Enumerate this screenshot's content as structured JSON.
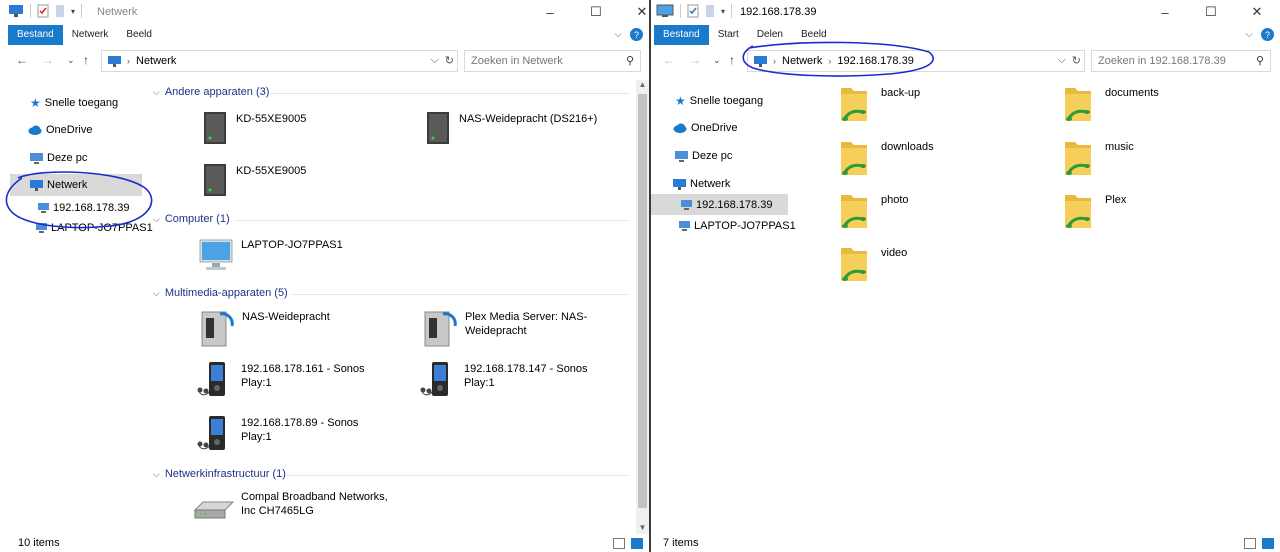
{
  "left": {
    "title": "Netwerk",
    "ribbon_tabs": [
      "Bestand",
      "Netwerk",
      "Beeld"
    ],
    "address": [
      "Netwerk"
    ],
    "search_placeholder": "Zoeken in Netwerk",
    "nav": [
      "Snelle toegang",
      "OneDrive",
      "Deze pc",
      "Netwerk",
      "192.168.178.39",
      "LAPTOP-JO7PPAS1"
    ],
    "groups": [
      {
        "header": "Andere apparaten (3)",
        "items": [
          "KD-55XE9005",
          "NAS-Weidepracht (DS216+)",
          "KD-55XE9005"
        ]
      },
      {
        "header": "Computer (1)",
        "items": [
          "LAPTOP-JO7PPAS1"
        ]
      },
      {
        "header": "Multimedia-apparaten (5)",
        "items": [
          "NAS-Weidepracht",
          "Plex Media Server: NAS-Weidepracht",
          "192.168.178.161 - Sonos Play:1",
          "192.168.178.147 - Sonos Play:1",
          "192.168.178.89 - Sonos Play:1"
        ]
      },
      {
        "header": "Netwerkinfrastructuur (1)",
        "items": [
          "Compal Broadband Networks, Inc CH7465LG"
        ]
      }
    ],
    "status": "10 items"
  },
  "right": {
    "title": "192.168.178.39",
    "ribbon_tabs": [
      "Bestand",
      "Start",
      "Delen",
      "Beeld"
    ],
    "address": [
      "Netwerk",
      "192.168.178.39"
    ],
    "search_placeholder": "Zoeken in 192.168.178.39",
    "nav": [
      "Snelle toegang",
      "OneDrive",
      "Deze pc",
      "Netwerk",
      "192.168.178.39",
      "LAPTOP-JO7PPAS1"
    ],
    "folders": [
      "back-up",
      "documents",
      "downloads",
      "music",
      "photo",
      "Plex",
      "video"
    ],
    "status": "7 items"
  },
  "colors": {
    "accent": "#1979ca",
    "group_header": "#1e3287",
    "annotation": "#1a2dcc"
  }
}
